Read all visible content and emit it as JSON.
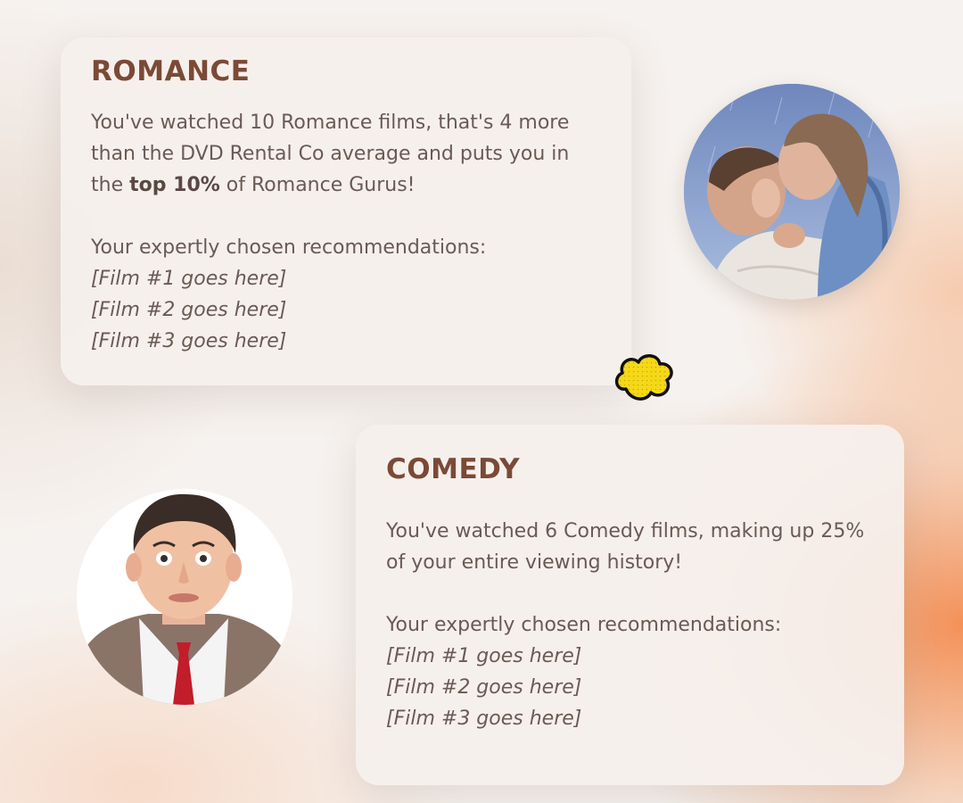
{
  "romance": {
    "title": "ROMANCE",
    "stat_line_1_before": "You've watched 10 Romance films, that's 4 more than the DVD Rental Co average and puts you in the ",
    "stat_bold": "top 10%",
    "stat_after": " of Romance Gurus!",
    "recommend_heading": "Your expertly chosen recommendations:",
    "recommendations": [
      "[Film #1 goes here]",
      "[Film #2 goes here]",
      "[Film #3 goes here]"
    ],
    "photo_icon": "couple-kissing-in-rain-photo"
  },
  "comedy": {
    "title": "COMEDY",
    "stat_line": "You've watched 6 Comedy films, making up 25% of your entire viewing history!",
    "recommend_heading": "Your expertly chosen recommendations:",
    "recommendations": [
      "[Film #1 goes here]",
      "[Film #2 goes here]",
      "[Film #3 goes here]"
    ],
    "photo_icon": "comedian-portrait-photo"
  },
  "decoration": {
    "icon": "popcorn-icon"
  },
  "colors": {
    "title": "#7a4a36",
    "text": "#6a5a54",
    "card": "#f5f0ed",
    "accent_orange": "#f3803e",
    "popcorn_yellow": "#f5d918"
  }
}
